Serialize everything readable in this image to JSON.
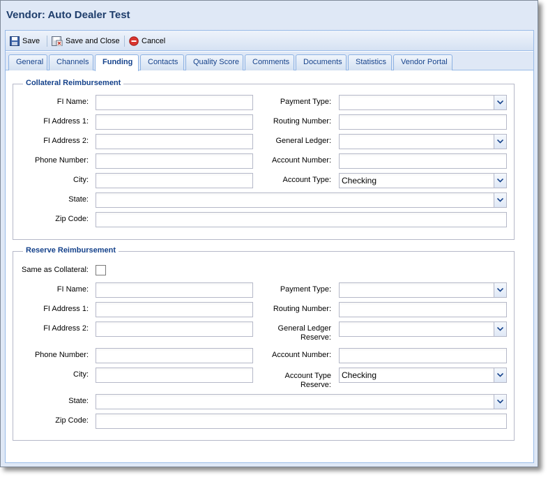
{
  "window": {
    "title": "Vendor: Auto Dealer Test"
  },
  "toolbar": {
    "save_label": "Save",
    "save_close_label": "Save and Close",
    "cancel_label": "Cancel"
  },
  "tabs": [
    "General",
    "Channels",
    "Funding",
    "Contacts",
    "Quality Score",
    "Comments",
    "Documents",
    "Statistics",
    "Vendor Portal"
  ],
  "active_tab": "Funding",
  "collateral": {
    "legend": "Collateral Reimbursement",
    "fi_name_label": "FI Name:",
    "fi_address1_label": "FI Address 1:",
    "fi_address2_label": "FI Address 2:",
    "phone_label": "Phone Number:",
    "city_label": "City:",
    "state_label": "State:",
    "zip_label": "Zip Code:",
    "payment_type_label": "Payment Type:",
    "routing_label": "Routing Number:",
    "gl_label": "General Ledger:",
    "account_number_label": "Account Number:",
    "account_type_label": "Account Type:",
    "fi_name": "",
    "fi_address1": "",
    "fi_address2": "",
    "phone": "",
    "city": "",
    "state": "",
    "zip": "",
    "payment_type": "",
    "routing": "",
    "gl": "",
    "account_number": "",
    "account_type": "Checking"
  },
  "reserve": {
    "legend": "Reserve Reimbursement",
    "same_as_label": "Same as Collateral:",
    "same_as_checked": false,
    "fi_name_label": "FI Name:",
    "fi_address1_label": "FI Address 1:",
    "fi_address2_label": "FI Address 2:",
    "phone_label": "Phone Number:",
    "city_label": "City:",
    "state_label": "State:",
    "zip_label": "Zip Code:",
    "payment_type_label": "Payment Type:",
    "routing_label": "Routing Number:",
    "gl_label_line1": "General Ledger",
    "gl_label_line2": "Reserve:",
    "account_number_label": "Account Number:",
    "account_type_label_line1": "Account Type",
    "account_type_label_line2": "Reserve:",
    "fi_name": "",
    "fi_address1": "",
    "fi_address2": "",
    "phone": "",
    "city": "",
    "state": "",
    "zip": "",
    "payment_type": "",
    "routing": "",
    "gl": "",
    "account_number": "",
    "account_type": "Checking"
  },
  "icons": {
    "save": "floppy-disk-icon",
    "save_close": "floppy-close-icon",
    "cancel": "cancel-circle-icon",
    "dropdown": "chevron-down-icon"
  },
  "colors": {
    "title": "#1e3d6b",
    "legend": "#15428b",
    "border": "#99bbe8",
    "cancel": "#d9352f"
  }
}
